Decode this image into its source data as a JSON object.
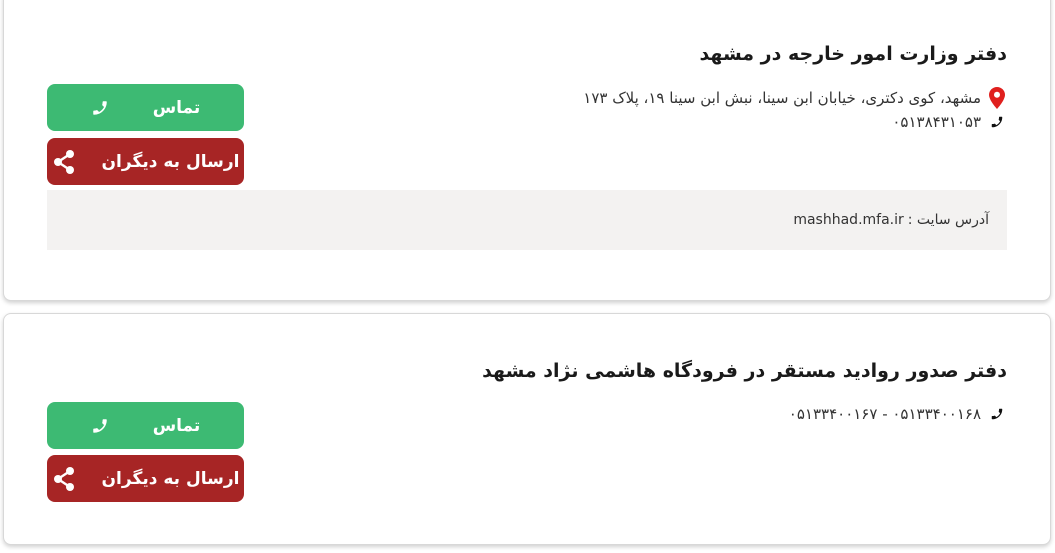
{
  "offices": [
    {
      "title": "دفتر وزارت امور خارجه در مشهد",
      "address": "مشهد، کوی دکتری، خیابان ابن سینا، نبش ابن سینا ۱۹، پلاک ۱۷۳",
      "phone": "۰۵۱۳۸۴۳۱۰۵۳",
      "website_label": "آدرس سایت :",
      "website": "mashhad.mfa.ir",
      "call_label": "تماس",
      "share_label": "ارسال به دیگران"
    },
    {
      "title": "دفتر صدور روادید مستقر در فرودگاه هاشمی نژاد مشهد",
      "phone": "۰۵۱۳۳۴۰۰۱۶۸ - ۰۵۱۳۳۴۰۰۱۶۷",
      "call_label": "تماس",
      "share_label": "ارسال به دیگران"
    }
  ],
  "colors": {
    "call_button": "#3dba73",
    "share_button": "#a72525",
    "location_icon": "#e0201e"
  },
  "icons": [
    "location-pin-icon",
    "phone-icon",
    "share-icon"
  ]
}
